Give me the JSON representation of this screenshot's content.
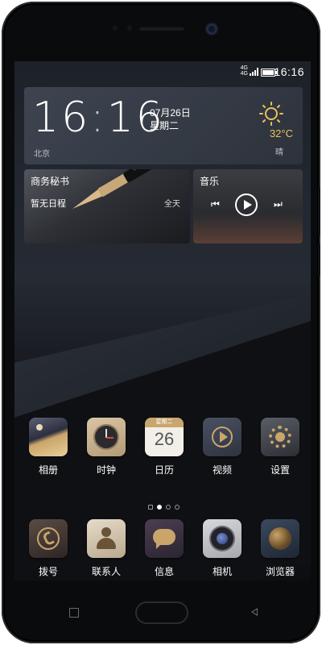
{
  "status": {
    "network": "4G\n4G",
    "time": "16:16"
  },
  "clock": {
    "time_h": "16",
    "time_m": "16",
    "date": "07月26日",
    "weekday": "星期二",
    "city": "北京",
    "temp": "32°C",
    "weather": "晴"
  },
  "secretary": {
    "title": "商务秘书",
    "subtitle": "暂无日程",
    "all_day": "全天"
  },
  "music": {
    "title": "音乐",
    "prev": "⏮",
    "next": "⏭"
  },
  "apps_row1": [
    {
      "label": "相册",
      "icon": "gallery-icon"
    },
    {
      "label": "时钟",
      "icon": "clock-icon"
    },
    {
      "label": "日历",
      "icon": "calendar-icon",
      "cal_day": "26",
      "cal_header": "星期二"
    },
    {
      "label": "视频",
      "icon": "video-icon"
    },
    {
      "label": "设置",
      "icon": "settings-icon"
    }
  ],
  "apps_dock": [
    {
      "label": "拨号",
      "icon": "phone-icon"
    },
    {
      "label": "联系人",
      "icon": "contacts-icon"
    },
    {
      "label": "信息",
      "icon": "message-icon"
    },
    {
      "label": "相机",
      "icon": "camera-icon"
    },
    {
      "label": "浏览器",
      "icon": "browser-icon"
    }
  ],
  "colors": {
    "gold": "#e8c25e",
    "bg": "#0d0e11"
  }
}
